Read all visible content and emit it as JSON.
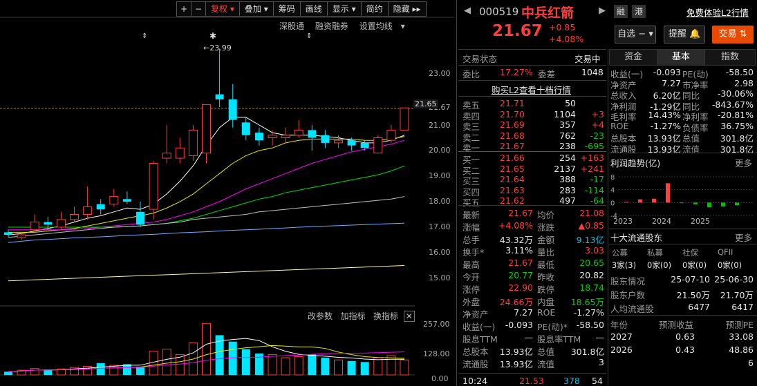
{
  "toolbar": {
    "plus": "+",
    "minus": "−",
    "fuquan": "复权",
    "diejia": "叠加",
    "chouma": "筹码",
    "huaxian": "画线",
    "xianshi": "显示",
    "jianyue": "简约",
    "yincang": "隐藏"
  },
  "subbar": {
    "a": "深股通",
    "b": "融资融券",
    "c": "设置均线"
  },
  "kline": {
    "high_marker": "23.99",
    "last_price_tag": "21.65",
    "y_ticks": [
      "23.00",
      "21.67",
      "21.00",
      "20.00",
      "19.00",
      "18.00",
      "17.00",
      "16.00",
      "15.00"
    ],
    "candles": [
      {
        "o": 16.8,
        "c": 16.7,
        "h": 16.9,
        "l": 16.6
      },
      {
        "o": 16.6,
        "c": 16.7,
        "h": 16.8,
        "l": 16.5
      },
      {
        "o": 16.9,
        "c": 17.2,
        "h": 17.5,
        "l": 16.8
      },
      {
        "o": 17.2,
        "c": 17.1,
        "h": 17.4,
        "l": 16.9
      },
      {
        "o": 17.0,
        "c": 17.3,
        "h": 17.6,
        "l": 16.9
      },
      {
        "o": 17.3,
        "c": 17.5,
        "h": 17.8,
        "l": 17.2
      },
      {
        "o": 17.5,
        "c": 17.8,
        "h": 18.6,
        "l": 17.3
      },
      {
        "o": 17.9,
        "c": 17.7,
        "h": 18.1,
        "l": 17.5
      },
      {
        "o": 17.9,
        "c": 18.2,
        "h": 18.5,
        "l": 17.8
      },
      {
        "o": 18.1,
        "c": 18.0,
        "h": 18.4,
        "l": 17.9
      },
      {
        "o": 17.6,
        "c": 17.1,
        "h": 18.0,
        "l": 17.0
      },
      {
        "o": 17.7,
        "c": 19.5,
        "h": 19.6,
        "l": 17.3
      },
      {
        "o": 19.7,
        "c": 19.9,
        "h": 21.0,
        "l": 19.5
      },
      {
        "o": 19.7,
        "c": 20.1,
        "h": 20.5,
        "l": 19.5
      },
      {
        "o": 19.8,
        "c": 20.8,
        "h": 21.0,
        "l": 19.6
      },
      {
        "o": 19.9,
        "c": 21.8,
        "h": 21.8,
        "l": 19.5
      },
      {
        "o": 22.2,
        "c": 22.0,
        "h": 23.99,
        "l": 21.7
      },
      {
        "o": 22.0,
        "c": 21.2,
        "h": 22.6,
        "l": 20.9
      },
      {
        "o": 21.1,
        "c": 20.6,
        "h": 21.3,
        "l": 20.4
      },
      {
        "o": 20.7,
        "c": 20.4,
        "h": 20.9,
        "l": 20.2
      },
      {
        "o": 20.5,
        "c": 20.6,
        "h": 20.8,
        "l": 20.2
      },
      {
        "o": 20.5,
        "c": 20.6,
        "h": 20.9,
        "l": 20.3
      },
      {
        "o": 20.6,
        "c": 20.8,
        "h": 21.2,
        "l": 20.5
      },
      {
        "o": 20.8,
        "c": 20.5,
        "h": 21.0,
        "l": 20.0
      },
      {
        "o": 20.6,
        "c": 20.3,
        "h": 20.8,
        "l": 20.1
      },
      {
        "o": 20.3,
        "c": 20.4,
        "h": 20.6,
        "l": 20.1
      },
      {
        "o": 20.4,
        "c": 20.2,
        "h": 20.5,
        "l": 20.0
      },
      {
        "o": 20.3,
        "c": 20.1,
        "h": 20.4,
        "l": 20.0
      },
      {
        "o": 19.9,
        "c": 20.5,
        "h": 20.6,
        "l": 19.9
      },
      {
        "o": 20.4,
        "c": 20.8,
        "h": 21.0,
        "l": 20.3
      },
      {
        "o": 20.8,
        "c": 21.67,
        "h": 21.67,
        "l": 20.8
      }
    ],
    "ma_values": [
      {
        "name": "MA5",
        "color": "#ffffff",
        "values": [
          16.7,
          16.75,
          16.85,
          16.95,
          17.05,
          17.2,
          17.35,
          17.45,
          17.6,
          17.75,
          17.7,
          17.9,
          18.3,
          18.8,
          19.4,
          20.2,
          20.9,
          21.3,
          21.3,
          21.0,
          20.7,
          20.6,
          20.6,
          20.6,
          20.55,
          20.5,
          20.4,
          20.3,
          20.3,
          20.4,
          20.6
        ]
      },
      {
        "name": "MA10",
        "color": "#e8e800",
        "values": [
          16.8,
          16.8,
          16.8,
          16.85,
          16.9,
          16.95,
          17.05,
          17.15,
          17.25,
          17.35,
          17.45,
          17.55,
          17.75,
          18.0,
          18.3,
          18.7,
          19.1,
          19.5,
          19.8,
          20.0,
          20.1,
          20.3,
          20.4,
          20.45,
          20.45,
          20.45,
          20.45,
          20.4,
          20.4,
          20.45,
          20.55
        ]
      },
      {
        "name": "MA20",
        "color": "#ff00ff",
        "values": [
          16.9,
          16.9,
          16.9,
          16.9,
          16.9,
          16.92,
          16.95,
          17.0,
          17.05,
          17.1,
          17.15,
          17.2,
          17.3,
          17.45,
          17.6,
          17.8,
          18.0,
          18.25,
          18.5,
          18.7,
          18.9,
          19.1,
          19.3,
          19.5,
          19.65,
          19.8,
          19.95,
          20.05,
          20.15,
          20.25,
          20.4
        ]
      },
      {
        "name": "MA30",
        "color": "#00e000",
        "values": [
          17.0,
          17.0,
          17.0,
          17.0,
          17.0,
          17.0,
          17.0,
          17.0,
          17.0,
          17.02,
          17.05,
          17.1,
          17.15,
          17.25,
          17.35,
          17.5,
          17.65,
          17.8,
          17.95,
          18.1,
          18.2,
          18.35,
          18.45,
          18.55,
          18.65,
          18.75,
          18.85,
          18.95,
          19.05,
          19.2,
          19.4
        ]
      },
      {
        "name": "MA60",
        "color": "#c0c0c0",
        "values": [
          16.6,
          16.65,
          16.7,
          16.75,
          16.8,
          16.85,
          16.9,
          16.95,
          17.0,
          17.02,
          17.05,
          17.1,
          17.15,
          17.2,
          17.3,
          17.35,
          17.4,
          17.45,
          17.5,
          17.6,
          17.65,
          17.7,
          17.75,
          17.8,
          17.85,
          17.9,
          17.95,
          18.0,
          18.05,
          18.1,
          18.2
        ]
      },
      {
        "name": "MA120",
        "color": "#6bb0ff",
        "values": [
          16.4,
          16.45,
          16.5,
          16.52,
          16.55,
          16.58,
          16.6,
          16.62,
          16.65,
          16.68,
          16.7,
          16.72,
          16.75,
          16.78,
          16.8,
          16.82,
          16.85,
          16.88,
          16.9,
          16.92,
          16.95,
          16.97,
          17.0,
          17.02,
          17.04,
          17.06,
          17.08,
          17.1,
          17.12,
          17.14,
          17.16
        ]
      },
      {
        "name": "MA250",
        "color": "#fff7a0",
        "values": [
          14.9,
          14.92,
          14.94,
          14.96,
          14.98,
          15.0,
          15.02,
          15.04,
          15.06,
          15.08,
          15.1,
          15.12,
          15.14,
          15.16,
          15.18,
          15.2,
          15.22,
          15.24,
          15.26,
          15.28,
          15.3,
          15.32,
          15.34,
          15.36,
          15.38,
          15.4,
          15.42,
          15.44,
          15.46,
          15.48,
          15.5
        ]
      }
    ]
  },
  "volume": {
    "buttons": [
      "改参数",
      "加指标",
      "换指标"
    ],
    "y_ticks": [
      "257.00",
      "128.00",
      "0.00"
    ],
    "values": [
      15,
      22,
      30,
      25,
      28,
      35,
      40,
      55,
      45,
      50,
      38,
      110,
      120,
      95,
      150,
      240,
      185,
      155,
      120,
      100,
      95,
      80,
      85,
      95,
      80,
      70,
      65,
      60,
      80,
      90,
      70
    ]
  },
  "stock": {
    "code": "000519",
    "name": "中兵红箭",
    "badges": [
      "融",
      "港"
    ],
    "l2": "免费体验L2行情",
    "price": "21.67",
    "change": "+0.85",
    "pct": "+4.08%",
    "zixuan": "自选",
    "tixing": "提醒",
    "jiaoyi": "交易"
  },
  "status": {
    "label": "交易状态",
    "value": "交易中"
  },
  "weibi": {
    "l1": "委比",
    "v1": "17.27%",
    "l2": "委差",
    "v2": "1048"
  },
  "buy_l2": "购买L2查看十档行情",
  "asks": [
    {
      "n": "卖五",
      "p": "21.71",
      "v": "50",
      "d": ""
    },
    {
      "n": "卖四",
      "p": "21.70",
      "v": "1104",
      "d": "+3"
    },
    {
      "n": "卖三",
      "p": "21.69",
      "v": "357",
      "d": "+4"
    },
    {
      "n": "卖二",
      "p": "21.68",
      "v": "762",
      "d": "-23"
    },
    {
      "n": "卖一",
      "p": "21.67",
      "v": "238",
      "d": "-695"
    }
  ],
  "bids": [
    {
      "n": "买一",
      "p": "21.66",
      "v": "254",
      "d": "+163"
    },
    {
      "n": "买二",
      "p": "21.65",
      "v": "2137",
      "d": "+241"
    },
    {
      "n": "买三",
      "p": "21.64",
      "v": "388",
      "d": "-17"
    },
    {
      "n": "买四",
      "p": "21.63",
      "v": "283",
      "d": "-114"
    },
    {
      "n": "买五",
      "p": "21.62",
      "v": "497",
      "d": "-64"
    }
  ],
  "quote": [
    {
      "l": "最新",
      "v": "21.67",
      "vc": "red",
      "l2": "均价",
      "v2": "21.08",
      "v2c": "red"
    },
    {
      "l": "涨幅",
      "v": "+4.08%",
      "vc": "red",
      "l2": "涨跌",
      "v2": "▲0.85",
      "v2c": "red"
    },
    {
      "l": "总手",
      "v": "43.32万",
      "vc": "white",
      "l2": "金额",
      "v2": "9.13亿",
      "v2c": "cyan"
    },
    {
      "l": "换手*",
      "v": "3.11%",
      "vc": "white",
      "l2": "量比",
      "v2": "3.03",
      "v2c": "red"
    },
    {
      "l": "最高",
      "v": "21.67",
      "vc": "red",
      "l2": "最低",
      "v2": "20.65",
      "v2c": "green"
    },
    {
      "l": "今开",
      "v": "20.77",
      "vc": "green",
      "l2": "昨收",
      "v2": "20.82",
      "v2c": "white"
    },
    {
      "l": "涨停",
      "v": "22.90",
      "vc": "red",
      "l2": "跌停",
      "v2": "18.74",
      "v2c": "green"
    },
    {
      "l": "外盘",
      "v": "24.66万",
      "vc": "red",
      "l2": "内盘",
      "v2": "18.65万",
      "v2c": "green"
    },
    {
      "l": "净资产",
      "v": "7.27",
      "vc": "white",
      "l2": "ROE",
      "v2": "-1.27%",
      "v2c": "white"
    },
    {
      "l": "收益(一)",
      "v": "-0.093",
      "vc": "white",
      "l2": "PE(动)*",
      "v2": "-58.50",
      "v2c": "white"
    },
    {
      "l": "股息TTM",
      "v": "—",
      "vc": "white",
      "l2": "股息率TTM",
      "v2": "—",
      "v2c": "white"
    },
    {
      "l": "总股本",
      "v": "13.93亿",
      "vc": "white",
      "l2": "总值",
      "v2": "301.8亿",
      "v2c": "white"
    },
    {
      "l": "流通股",
      "v": "13.93亿",
      "vc": "white",
      "l2": "流值",
      "v2": "3",
      "v2c": "white"
    }
  ],
  "tick": {
    "time": "10:24",
    "price": "21.53",
    "vol": "378",
    "n": "54"
  },
  "tabs": [
    "资金",
    "基本",
    "指数"
  ],
  "fundamentals": [
    {
      "l": "收益(一)",
      "v": "-0.093",
      "l2": "PE(动)",
      "v2": "-58.50"
    },
    {
      "l": "净资产",
      "v": "7.27",
      "l2": "市净率",
      "v2": "2.98"
    },
    {
      "l": "总收入",
      "v": "6.20亿",
      "l2": "同比",
      "v2": "-30.06%"
    },
    {
      "l": "净利润",
      "v": "-1.29亿",
      "l2": "同比",
      "v2": "-843.67%"
    },
    {
      "l": "毛利率",
      "v": "14.43%",
      "l2": "净利率",
      "v2": "-20.81%"
    },
    {
      "l": "ROE",
      "v": "-1.27%",
      "l2": "负债率",
      "v2": "36.75%"
    },
    {
      "l": "总股本",
      "v": "13.93亿",
      "l2": "总值",
      "v2": "301.8亿"
    },
    {
      "l": "流通股",
      "v": "13.93亿",
      "l2": "流值",
      "v2": "301.8亿"
    }
  ],
  "profit_trend": {
    "title": "利润趋势(亿)",
    "more": "更多",
    "y_ticks": [
      "8",
      "4",
      "0",
      "-4"
    ],
    "years": [
      "2023",
      "2024",
      "2025"
    ],
    "chart_data": {
      "type": "bar",
      "values": [
        0.2,
        1.0,
        1.2,
        6.0,
        -0.2,
        -0.6,
        -1.5,
        -1.2,
        -0.8
      ],
      "ylim": [
        -4,
        8
      ]
    }
  },
  "holders": {
    "title": "十大流通股东",
    "more": "更多",
    "cols": [
      "公募",
      "私募",
      "社保",
      "QFII"
    ],
    "vals": [
      "3家(3)",
      "0家(0)",
      "0家(0)",
      "0家(0)"
    ],
    "rows": [
      {
        "l": "股东情况",
        "a": "25-07-10",
        "b": "25-06-30"
      },
      {
        "l": "股东户数",
        "a": "21.50万",
        "b": "21.70万"
      },
      {
        "l": "人均流通股",
        "a": "6477",
        "b": "6417"
      }
    ]
  },
  "forecast": {
    "h1": "年份",
    "h2": "预测收益",
    "h3": "预测PE",
    "rows": [
      {
        "y": "2027",
        "e": "0.63",
        "pe": "33.08"
      },
      {
        "y": "2026",
        "e": "0.43",
        "pe": "48.86"
      },
      {
        "y": "",
        "e": "",
        "pe": "6"
      }
    ]
  }
}
